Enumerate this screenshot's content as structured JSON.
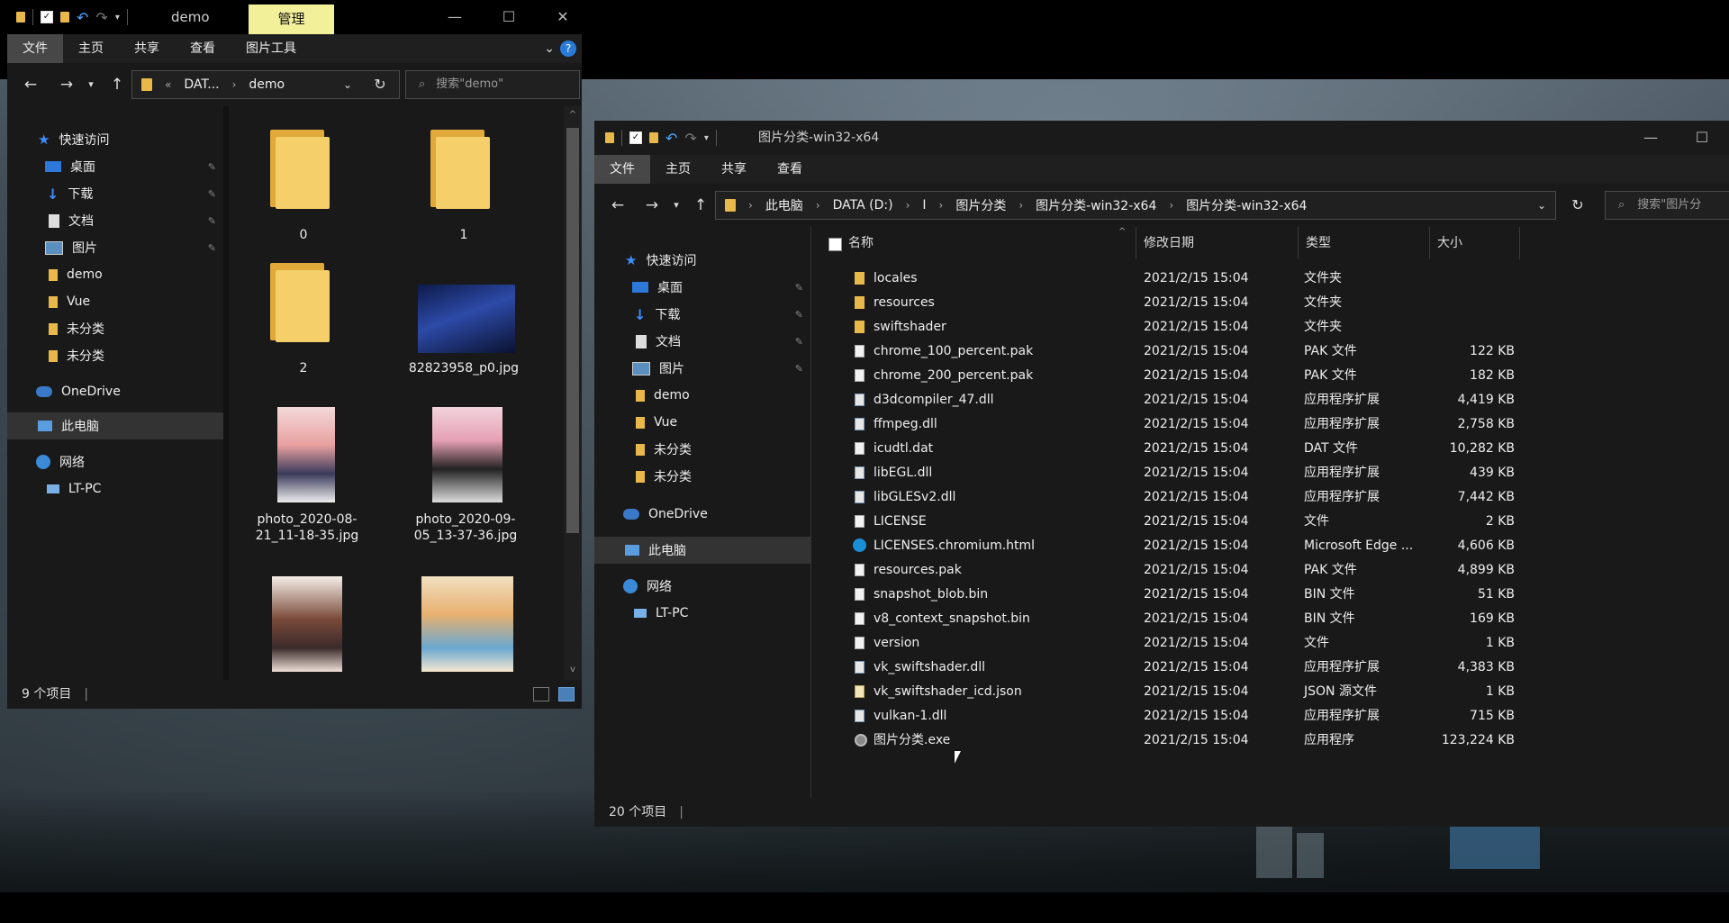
{
  "left": {
    "title": "demo",
    "manage_tab": "管理",
    "ribbon_tabs": [
      "文件",
      "主页",
      "共享",
      "查看",
      "图片工具"
    ],
    "breadcrumb": [
      "DAT...",
      "demo"
    ],
    "search_placeholder": "搜索\"demo\"",
    "nav": [
      "快速访问",
      "桌面",
      "下载",
      "文档",
      "图片",
      "demo",
      "Vue",
      "未分类",
      "未分类",
      "OneDrive",
      "此电脑",
      "网络",
      "LT-PC"
    ],
    "files": [
      "0",
      "1",
      "2",
      "82823958_p0.jpg",
      "photo_2020-08-21_11-18-35.jpg",
      "photo_2020-09-05_13-37-36.jpg"
    ],
    "status": "9 个项目"
  },
  "right": {
    "title": "图片分类-win32-x64",
    "ribbon_tabs": [
      "文件",
      "主页",
      "共享",
      "查看"
    ],
    "breadcrumb": [
      "此电脑",
      "DATA (D:)",
      "I",
      "图片分类",
      "图片分类-win32-x64",
      "图片分类-win32-x64"
    ],
    "search_placeholder": "搜索\"图片分",
    "nav": [
      "快速访问",
      "桌面",
      "下载",
      "文档",
      "图片",
      "demo",
      "Vue",
      "未分类",
      "未分类",
      "OneDrive",
      "此电脑",
      "网络",
      "LT-PC"
    ],
    "columns": [
      "名称",
      "修改日期",
      "类型",
      "大小"
    ],
    "rows": [
      {
        "name": "locales",
        "date": "2021/2/15 15:04",
        "type": "文件夹",
        "size": "",
        "icon": "folder"
      },
      {
        "name": "resources",
        "date": "2021/2/15 15:04",
        "type": "文件夹",
        "size": "",
        "icon": "folder"
      },
      {
        "name": "swiftshader",
        "date": "2021/2/15 15:04",
        "type": "文件夹",
        "size": "",
        "icon": "folder"
      },
      {
        "name": "chrome_100_percent.pak",
        "date": "2021/2/15 15:04",
        "type": "PAK 文件",
        "size": "122 KB",
        "icon": "file"
      },
      {
        "name": "chrome_200_percent.pak",
        "date": "2021/2/15 15:04",
        "type": "PAK 文件",
        "size": "182 KB",
        "icon": "file"
      },
      {
        "name": "d3dcompiler_47.dll",
        "date": "2021/2/15 15:04",
        "type": "应用程序扩展",
        "size": "4,419 KB",
        "icon": "dll"
      },
      {
        "name": "ffmpeg.dll",
        "date": "2021/2/15 15:04",
        "type": "应用程序扩展",
        "size": "2,758 KB",
        "icon": "dll"
      },
      {
        "name": "icudtl.dat",
        "date": "2021/2/15 15:04",
        "type": "DAT 文件",
        "size": "10,282 KB",
        "icon": "file"
      },
      {
        "name": "libEGL.dll",
        "date": "2021/2/15 15:04",
        "type": "应用程序扩展",
        "size": "439 KB",
        "icon": "dll"
      },
      {
        "name": "libGLESv2.dll",
        "date": "2021/2/15 15:04",
        "type": "应用程序扩展",
        "size": "7,442 KB",
        "icon": "dll"
      },
      {
        "name": "LICENSE",
        "date": "2021/2/15 15:04",
        "type": "文件",
        "size": "2 KB",
        "icon": "file"
      },
      {
        "name": "LICENSES.chromium.html",
        "date": "2021/2/15 15:04",
        "type": "Microsoft Edge ...",
        "size": "4,606 KB",
        "icon": "edge"
      },
      {
        "name": "resources.pak",
        "date": "2021/2/15 15:04",
        "type": "PAK 文件",
        "size": "4,899 KB",
        "icon": "file"
      },
      {
        "name": "snapshot_blob.bin",
        "date": "2021/2/15 15:04",
        "type": "BIN 文件",
        "size": "51 KB",
        "icon": "file"
      },
      {
        "name": "v8_context_snapshot.bin",
        "date": "2021/2/15 15:04",
        "type": "BIN 文件",
        "size": "169 KB",
        "icon": "file"
      },
      {
        "name": "version",
        "date": "2021/2/15 15:04",
        "type": "文件",
        "size": "1 KB",
        "icon": "file"
      },
      {
        "name": "vk_swiftshader.dll",
        "date": "2021/2/15 15:04",
        "type": "应用程序扩展",
        "size": "4,383 KB",
        "icon": "dll"
      },
      {
        "name": "vk_swiftshader_icd.json",
        "date": "2021/2/15 15:04",
        "type": "JSON 源文件",
        "size": "1 KB",
        "icon": "json"
      },
      {
        "name": "vulkan-1.dll",
        "date": "2021/2/15 15:04",
        "type": "应用程序扩展",
        "size": "715 KB",
        "icon": "dll"
      },
      {
        "name": "图片分类.exe",
        "date": "2021/2/15 15:04",
        "type": "应用程序",
        "size": "123,224 KB",
        "icon": "exe"
      }
    ],
    "status": "20 个项目"
  }
}
